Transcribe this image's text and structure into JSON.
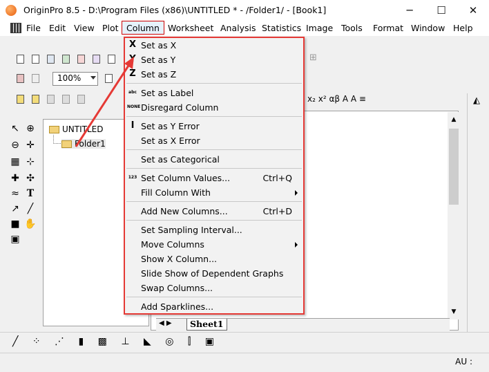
{
  "window": {
    "title": "OriginPro 8.5 - D:\\Program Files (x86)\\UNTITLED * - /Folder1/ - [Book1]",
    "minimize": "─",
    "maximize": "☐",
    "close": "✕"
  },
  "menubar": {
    "items": [
      "File",
      "Edit",
      "View",
      "Plot",
      "Column",
      "Worksheet",
      "Analysis",
      "Statistics",
      "Image",
      "Tools",
      "Format",
      "Window",
      "Help"
    ],
    "active": "Column"
  },
  "toolbar": {
    "zoom": "100%",
    "format_glyphs": "x₂ x² αβ A A ≡"
  },
  "project": {
    "root": "UNTITLED",
    "folder": "Folder1"
  },
  "sheet": {
    "tab": "Sheet1"
  },
  "status": {
    "au": "AU :"
  },
  "column_menu": {
    "items": [
      {
        "icon": "X",
        "label": "Set as X",
        "shortcut": "",
        "submenu": false
      },
      {
        "icon": "Y",
        "label": "Set as Y",
        "shortcut": "",
        "submenu": false
      },
      {
        "icon": "Z",
        "label": "Set as Z",
        "shortcut": "",
        "submenu": false
      },
      {
        "icon": "abc",
        "label": "Set as Label",
        "shortcut": "",
        "submenu": false
      },
      {
        "icon": "NONE",
        "label": "Disregard Column",
        "shortcut": "",
        "submenu": false
      },
      {
        "icon": "I",
        "label": "Set as Y Error",
        "shortcut": "",
        "submenu": false
      },
      {
        "icon": "",
        "label": "Set as X Error",
        "shortcut": "",
        "submenu": false
      },
      {
        "icon": "",
        "label": "Set as Categorical",
        "shortcut": "",
        "submenu": false
      },
      {
        "icon": "123",
        "label": "Set Column Values...",
        "shortcut": "Ctrl+Q",
        "submenu": false
      },
      {
        "icon": "",
        "label": "Fill Column With",
        "shortcut": "",
        "submenu": true
      },
      {
        "icon": "",
        "label": "Add New Columns...",
        "shortcut": "Ctrl+D",
        "submenu": false
      },
      {
        "icon": "",
        "label": "Set Sampling Interval...",
        "shortcut": "",
        "submenu": false
      },
      {
        "icon": "",
        "label": "Move Columns",
        "shortcut": "",
        "submenu": true
      },
      {
        "icon": "",
        "label": "Show X Column...",
        "shortcut": "",
        "submenu": false
      },
      {
        "icon": "",
        "label": "Slide Show of Dependent Graphs",
        "shortcut": "",
        "submenu": false
      },
      {
        "icon": "",
        "label": "Swap Columns...",
        "shortcut": "",
        "submenu": false
      },
      {
        "icon": "",
        "label": "Add Sparklines...",
        "shortcut": "",
        "submenu": false
      }
    ]
  },
  "colors": {
    "highlight_red": "#e53935",
    "menu_bg": "#f2f2f2"
  }
}
